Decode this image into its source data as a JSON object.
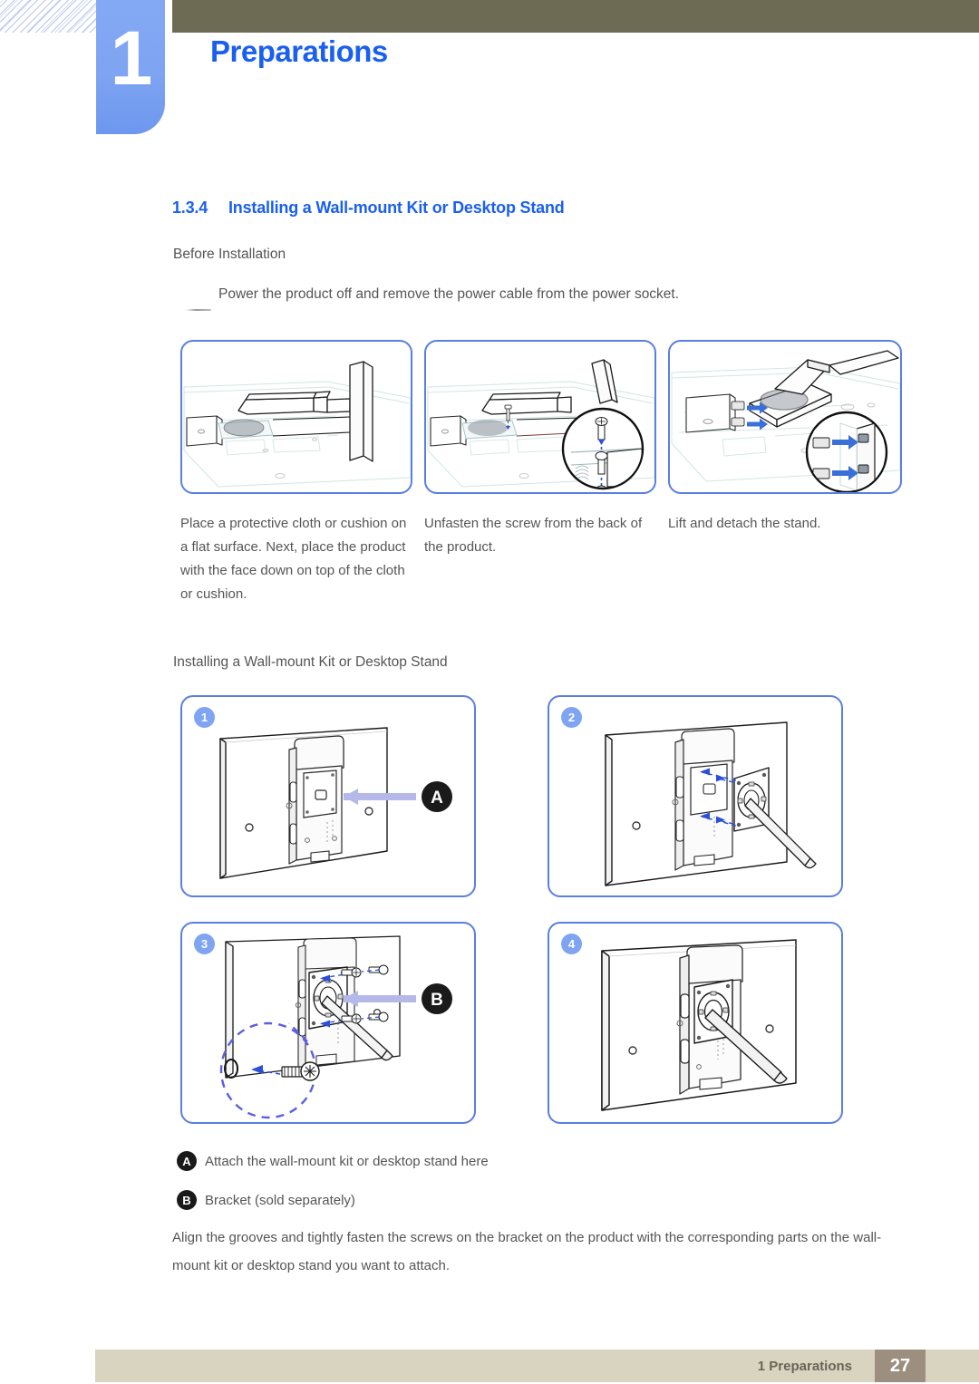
{
  "header": {
    "chapter_number": "1",
    "chapter_title": "Preparations"
  },
  "section": {
    "number": "1.3.4",
    "title": "Installing a Wall-mount Kit or Desktop Stand",
    "before_installation_label": "Before Installation",
    "before_installation_note": "Power the product off and remove the power cable from the power socket."
  },
  "removal_steps": [
    {
      "caption": "Place a protective cloth or cushion on a flat surface. Next, place the product with the face down on top of the cloth or cushion.",
      "figure": "monitor-face-down-with-stand"
    },
    {
      "caption": "Unfasten the screw from the back of the product.",
      "figure": "unfasten-screw-magnified"
    },
    {
      "caption": "Lift and detach the stand.",
      "figure": "lift-detach-stand-arrows"
    }
  ],
  "install": {
    "subsection_title": "Installing a Wall-mount Kit or Desktop Stand",
    "steps": [
      {
        "number": "1",
        "marker": "A",
        "figure": "monitor-back-attach-point"
      },
      {
        "number": "2",
        "marker": "",
        "figure": "bracket-align-dashed-arrows"
      },
      {
        "number": "3",
        "marker": "B",
        "figure": "fasten-screws-detail-circle"
      },
      {
        "number": "4",
        "marker": "",
        "figure": "bracket-installed-final"
      }
    ]
  },
  "legend": [
    {
      "badge": "A",
      "text": "Attach the wall-mount kit or desktop stand here"
    },
    {
      "badge": "B",
      "text": "Bracket (sold separately)"
    }
  ],
  "closing_paragraph": "Align the grooves and tightly fasten the screws on the bracket on the product with the corresponding parts on the wall-mount kit or desktop stand you want to attach.",
  "footer": {
    "chapter_label": "1 Preparations",
    "page_number": "27"
  },
  "colors": {
    "accent_blue": "#1a5ff0",
    "tab_blue": "#7ea4f2",
    "panel_border": "#5b7fe0",
    "olive": "#6e6b55",
    "footer_beige": "#d9d4c0",
    "page_box": "#9d8f7f",
    "body_text": "#555555"
  }
}
